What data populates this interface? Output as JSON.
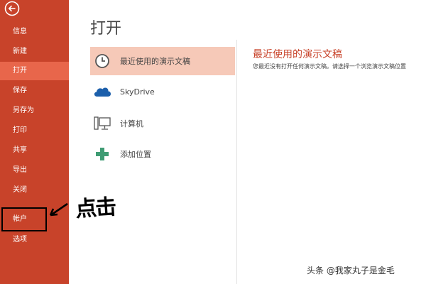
{
  "sidebar": {
    "items": [
      {
        "label": "信息"
      },
      {
        "label": "新建"
      },
      {
        "label": "打开"
      },
      {
        "label": "保存"
      },
      {
        "label": "另存为"
      },
      {
        "label": "打印"
      },
      {
        "label": "共享"
      },
      {
        "label": "导出"
      },
      {
        "label": "关闭"
      },
      {
        "label": "帐户"
      },
      {
        "label": "选项"
      }
    ],
    "active_item": "打开"
  },
  "main": {
    "title": "打开",
    "places": [
      {
        "label": "最近使用的演示文稿",
        "icon": "clock-icon"
      },
      {
        "label": "SkyDrive",
        "icon": "cloud-icon"
      },
      {
        "label": "计算机",
        "icon": "computer-icon"
      },
      {
        "label": "添加位置",
        "icon": "plus-icon"
      }
    ],
    "recent": {
      "title": "最近使用的演示文稿",
      "description": "您最近没有打开任何演示文稿。请选择一个浏览演示文稿位置"
    }
  },
  "annotation": {
    "text": "点击"
  },
  "watermark": "头条 @我家丸子是金毛",
  "colors": {
    "accent": "#c8432a",
    "active": "#e8664b",
    "selected": "#f6c9b8"
  }
}
